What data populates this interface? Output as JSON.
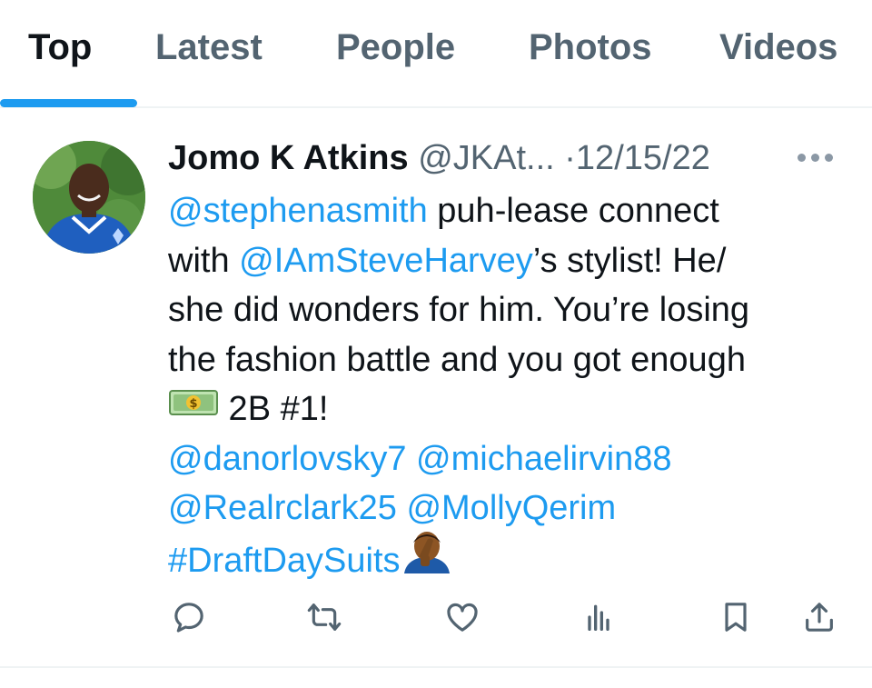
{
  "tabs": [
    {
      "label": "Top",
      "active": true
    },
    {
      "label": "Latest",
      "active": false
    },
    {
      "label": "People",
      "active": false
    },
    {
      "label": "Photos",
      "active": false
    },
    {
      "label": "Videos",
      "active": false
    }
  ],
  "tweet": {
    "display_name": "Jomo K Atkins",
    "handle": "@JKAt...",
    "separator": "·",
    "date": "12/15/22",
    "lines": {
      "l1_mention": "@stephenasmith",
      "l1_text": " puh-lease connect",
      "l2_prefix": "with ",
      "l2_mention": "@IAmSteveHarvey",
      "l2_text": "’s stylist! He/",
      "l3_text": "she did wonders for him. You’re losing",
      "l4_text": "the fashion battle and you got enough",
      "l5_text": " 2B #1!",
      "l6_mention_a": "@danorlovsky7",
      "l6_mention_b": "@michaelirvin88",
      "l7_mention_a": "@Realrclark25",
      "l7_mention_b": "@MollyQerim",
      "l8_hashtag": "#DraftDaySuits"
    },
    "emojis": [
      "money-with-dollar-bill-emoji",
      "face-palm-emoji"
    ]
  },
  "actions": [
    "reply-icon",
    "retweet-icon",
    "like-icon",
    "views-icon",
    "bookmark-icon",
    "share-icon"
  ],
  "colors": {
    "accent": "#1d9bf0",
    "text_primary": "#0f1419",
    "text_secondary": "#536471",
    "divider": "#eff3f4"
  }
}
